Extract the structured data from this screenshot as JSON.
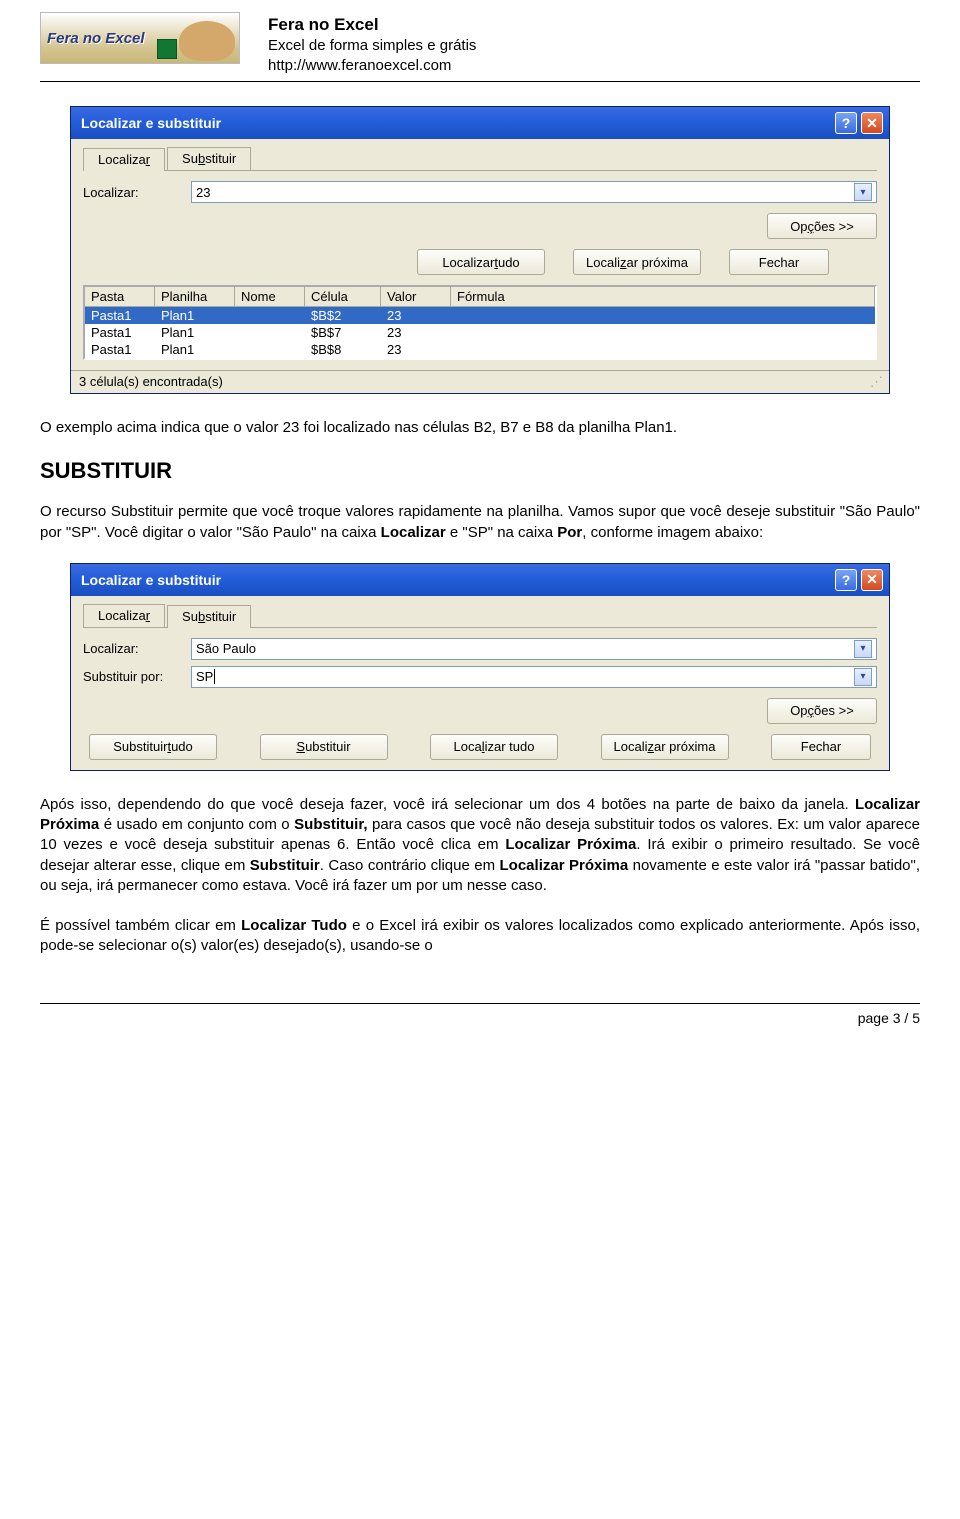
{
  "header": {
    "logo_text": "Fera no Excel",
    "site_title": "Fera no Excel",
    "site_subtitle": "Excel de forma simples e grátis",
    "site_url": "http://www.feranoexcel.com"
  },
  "dialog1": {
    "title": "Localizar e substituir",
    "tabs": {
      "find": "Localizar",
      "replace": "Substituir",
      "find_u": "r",
      "replace_u": "b"
    },
    "active_tab": "find",
    "find_label": "Localizar:",
    "find_value": "23",
    "options_label": "Opções >>",
    "buttons": {
      "find_all": "Localizar tudo",
      "find_next": "Localizar próxima",
      "close": "Fechar"
    },
    "results": {
      "headers": [
        "Pasta",
        "Planilha",
        "Nome",
        "Célula",
        "Valor",
        "Fórmula"
      ],
      "rows": [
        {
          "pasta": "Pasta1",
          "plan": "Plan1",
          "nome": "",
          "cel": "$B$2",
          "val": "23",
          "form": "",
          "selected": true
        },
        {
          "pasta": "Pasta1",
          "plan": "Plan1",
          "nome": "",
          "cel": "$B$7",
          "val": "23",
          "form": "",
          "selected": false
        },
        {
          "pasta": "Pasta1",
          "plan": "Plan1",
          "nome": "",
          "cel": "$B$8",
          "val": "23",
          "form": "",
          "selected": false
        }
      ],
      "status": "3 célula(s) encontrada(s)"
    }
  },
  "para1": "O exemplo acima indica que o valor 23 foi localizado nas células B2, B7 e B8 da planilha Plan1.",
  "heading_substituir": "SUBSTITUIR",
  "para2_a": "O recurso Substituir permite que você troque valores rapidamente na planilha. Vamos supor que você deseje substituir \"São Paulo\" por \"SP\". Você digitar o valor \"São Paulo\" na caixa ",
  "para2_b": "Localizar",
  "para2_c": " e \"SP\" na caixa ",
  "para2_d": "Por",
  "para2_e": ", conforme imagem abaixo:",
  "dialog2": {
    "title": "Localizar e substituir",
    "tabs": {
      "find": "Localizar",
      "replace": "Substituir"
    },
    "active_tab": "replace",
    "find_label": "Localizar:",
    "find_value": "São Paulo",
    "replace_label": "Substituir por:",
    "replace_value": "SP",
    "options_label": "Opções >>",
    "buttons": {
      "replace_all": "Substituir tudo",
      "replace": "Substituir",
      "find_all": "Localizar tudo",
      "find_next": "Localizar próxima",
      "close": "Fechar"
    }
  },
  "para3_a": "Após isso, dependendo do que você deseja fazer, você irá selecionar um dos 4 botões na parte de baixo da janela. ",
  "para3_b": "Localizar Próxima",
  "para3_c": " é usado em conjunto com o ",
  "para3_d": "Substituir,",
  "para3_e": " para casos que você não deseja substituir todos os valores. Ex: um valor aparece 10 vezes e você deseja substituir apenas 6. Então você clica em ",
  "para3_f": "Localizar Próxima",
  "para3_g": ". Irá exibir o primeiro resultado. Se você desejar alterar esse, clique em ",
  "para3_h": "Substituir",
  "para3_i": ". Caso contrário clique em ",
  "para3_j": "Localizar Próxima",
  "para3_k": " novamente e este valor irá \"passar batido\", ou seja, irá permanecer como estava. Você irá fazer um por um  nesse caso.",
  "para4_a": "É possível também clicar em ",
  "para4_b": "Localizar Tudo",
  "para4_c": " e o Excel irá exibir os valores localizados como explicado anteriormente. Após isso, pode-se selecionar o(s) valor(es) desejado(s), usando-se o",
  "footer": "page 3 / 5"
}
